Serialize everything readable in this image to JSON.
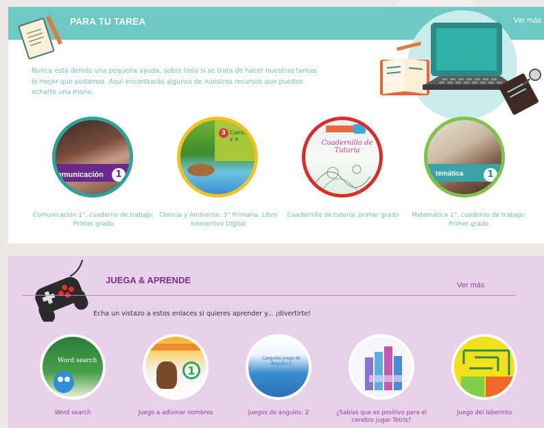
{
  "tarea": {
    "title": "PARA TU TAREA",
    "more": "Ver más",
    "description": "Nunca está demás una pequeña ayuda, sobre todo si se trata de hacer nuestras tareas lo mejor que podamos. Aquí encontrarás algunos de nuestros recursos que pueden echarte una mano.",
    "items": [
      {
        "caption_1": "Comunicación 1°, cuaderno de trabajo:",
        "caption_2": "Primer grado",
        "cover_text": "omunicación",
        "cover_num": "1",
        "ring": "#2aa39b"
      },
      {
        "caption_1": "Ciencia y Ambiente: 3° Primaria. Libro",
        "caption_2": "Interactivo Digital",
        "cover_text": "Ciencia y a",
        "cover_num": "3",
        "ring": "#f1c21d"
      },
      {
        "caption_1": "Cuadernillo de tutoría: primer grado",
        "caption_2": "",
        "cover_text": "Cuadernillo de Tutoría",
        "cover_num": "",
        "ring": "#dd2a2a"
      },
      {
        "caption_1": "Matemática 1°, cuaderno de trabajo:",
        "caption_2": "Primer grado",
        "cover_text": "temática",
        "cover_num": "1",
        "ring": "#7fc24a"
      }
    ]
  },
  "juega": {
    "title": "JUEGA & APRENDE",
    "more": "Ver más",
    "description": "Echa un vistazo a estos enlaces si quieres aprender y... ¡divertirte!",
    "items": [
      {
        "caption_1": "Word search",
        "caption_2": "",
        "cover_text": "Word search"
      },
      {
        "caption_1": "Juego a adivinar nombres",
        "caption_2": "",
        "cover_text": "1"
      },
      {
        "caption_1": "Juegos de ángulos: 2",
        "caption_2": "",
        "cover_text": "Cangulos juego de Ángulos 2"
      },
      {
        "caption_1": "¿Sabías que es positivo para el",
        "caption_2": "cerebro jugar Tetris?",
        "cover_text": ""
      },
      {
        "caption_1": "Juego del laberinto",
        "caption_2": "",
        "cover_text": ""
      }
    ]
  },
  "colors": {
    "teal": "#6ec8c4",
    "purple": "#7f2b87",
    "lavender": "#e7d1e9"
  }
}
